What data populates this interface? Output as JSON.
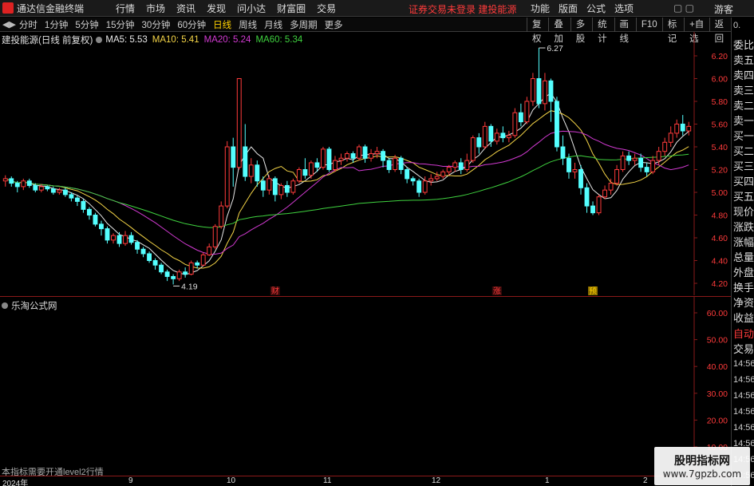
{
  "app": {
    "name": "通达信金融终端",
    "menus": [
      "行情",
      "市场",
      "资讯",
      "发现",
      "问小达",
      "财富圈",
      "交易"
    ],
    "broker_warning": "证券交易未登录  建投能源",
    "toolbar_right": [
      "功能",
      "版面",
      "公式",
      "选项"
    ],
    "guest_label": "游客"
  },
  "periods": {
    "items": [
      "分时",
      "1分钟",
      "5分钟",
      "15分钟",
      "30分钟",
      "60分钟",
      "日线",
      "周线",
      "月线",
      "多周期",
      "更多"
    ],
    "active": "日线",
    "right_buttons": [
      "复权",
      "叠加",
      "多股",
      "统计",
      "画线",
      "F10",
      "标记",
      "+自选",
      "返回"
    ]
  },
  "main_chart": {
    "stock_title": "建投能源(日线 前复权)",
    "ma_labels": [
      {
        "text": "MA5: 5.53",
        "color": "#e8e8e8"
      },
      {
        "text": "MA10: 5.41",
        "color": "#f5d547"
      },
      {
        "text": "MA20: 5.24",
        "color": "#d23ad2"
      },
      {
        "text": "MA60: 5.34",
        "color": "#3fd23f"
      }
    ],
    "annotations": {
      "high": "6.27",
      "low": "4.19"
    },
    "event_markers": [
      "财",
      "涨",
      "预"
    ]
  },
  "sub_chart": {
    "title": "乐淘公式网",
    "note": "本指标需要开通level2行情"
  },
  "time_axis": {
    "labels": [
      "2024年",
      "9",
      "10",
      "11",
      "12",
      "1",
      "2"
    ]
  },
  "right_panel": {
    "top_tag": "0.",
    "labels": [
      "委比",
      "卖五",
      "卖四",
      "卖三",
      "卖二",
      "卖一",
      "买一",
      "买二",
      "买三",
      "买四",
      "买五",
      "现价",
      "涨跌",
      "涨幅",
      "总量",
      "外盘",
      "换手",
      "净资",
      "收益",
      "自动",
      "交易"
    ],
    "times": [
      "14:56",
      "14:56",
      "14:56",
      "14:56",
      "14:56",
      "14:56",
      "14:56",
      "14:56"
    ]
  },
  "watermark": {
    "title": "股明指标网",
    "url": "www.7gpzb.com"
  },
  "chart_data": {
    "type": "candlestick",
    "price_axis": {
      "min": 4.2,
      "max": 6.2,
      "ticks": [
        "6.20",
        "6.00",
        "5.80",
        "5.60",
        "5.40",
        "5.20",
        "5.00",
        "4.80",
        "4.60",
        "4.40",
        "4.20"
      ]
    },
    "sub_axis": {
      "ticks": [
        "60.00",
        "50.00",
        "40.00",
        "30.00",
        "20.00",
        "10.00"
      ]
    },
    "candles": [
      [
        5.1,
        5.12,
        5.05,
        5.15
      ],
      [
        5.12,
        5.08,
        5.05,
        5.14
      ],
      [
        5.08,
        5.05,
        5.0,
        5.1
      ],
      [
        5.05,
        5.1,
        5.02,
        5.12
      ],
      [
        5.1,
        5.06,
        5.04,
        5.12
      ],
      [
        5.06,
        5.02,
        5.0,
        5.08
      ],
      [
        5.02,
        5.05,
        5.0,
        5.07
      ],
      [
        5.05,
        5.03,
        5.01,
        5.06
      ],
      [
        5.03,
        5.0,
        4.98,
        5.05
      ],
      [
        5.0,
        5.02,
        4.98,
        5.04
      ],
      [
        5.02,
        4.98,
        4.96,
        5.04
      ],
      [
        4.98,
        4.95,
        4.92,
        5.0
      ],
      [
        4.95,
        4.92,
        4.88,
        4.97
      ],
      [
        4.92,
        4.85,
        4.82,
        4.94
      ],
      [
        4.85,
        4.8,
        4.76,
        4.87
      ],
      [
        4.8,
        4.72,
        4.7,
        4.82
      ],
      [
        4.72,
        4.68,
        4.62,
        4.75
      ],
      [
        4.68,
        4.58,
        4.55,
        4.7
      ],
      [
        4.58,
        4.62,
        4.55,
        4.64
      ],
      [
        4.62,
        4.55,
        4.52,
        4.65
      ],
      [
        4.55,
        4.62,
        4.53,
        4.66
      ],
      [
        4.62,
        4.56,
        4.54,
        4.65
      ],
      [
        4.56,
        4.5,
        4.46,
        4.58
      ],
      [
        4.5,
        4.46,
        4.43,
        4.52
      ],
      [
        4.46,
        4.4,
        4.38,
        4.48
      ],
      [
        4.4,
        4.36,
        4.32,
        4.42
      ],
      [
        4.36,
        4.3,
        4.28,
        4.38
      ],
      [
        4.3,
        4.26,
        4.22,
        4.32
      ],
      [
        4.26,
        4.24,
        4.19,
        4.28
      ],
      [
        4.24,
        4.3,
        4.22,
        4.32
      ],
      [
        4.3,
        4.28,
        4.25,
        4.34
      ],
      [
        4.28,
        4.38,
        4.27,
        4.4
      ],
      [
        4.38,
        4.36,
        4.33,
        4.4
      ],
      [
        4.36,
        4.45,
        4.35,
        4.47
      ],
      [
        4.45,
        4.52,
        4.44,
        4.55
      ],
      [
        4.52,
        4.7,
        4.5,
        4.72
      ],
      [
        4.7,
        4.88,
        4.68,
        4.92
      ],
      [
        4.88,
        5.4,
        4.86,
        5.45
      ],
      [
        5.4,
        5.22,
        5.05,
        5.48
      ],
      [
        5.22,
        6.0,
        5.2,
        6.0
      ],
      [
        5.4,
        5.14,
        5.1,
        5.6
      ],
      [
        5.14,
        5.24,
        5.08,
        5.3
      ],
      [
        5.24,
        5.1,
        5.05,
        5.28
      ],
      [
        5.1,
        5.02,
        4.96,
        5.14
      ],
      [
        5.02,
        5.12,
        4.98,
        5.15
      ],
      [
        5.12,
        4.98,
        4.92,
        5.14
      ],
      [
        4.98,
        5.06,
        4.94,
        5.08
      ],
      [
        5.06,
        5.0,
        4.96,
        5.1
      ],
      [
        5.0,
        5.1,
        4.98,
        5.12
      ],
      [
        5.1,
        5.2,
        5.08,
        5.22
      ],
      [
        5.2,
        5.15,
        5.12,
        5.3
      ],
      [
        5.15,
        5.26,
        5.12,
        5.28
      ],
      [
        5.26,
        5.22,
        5.18,
        5.3
      ],
      [
        5.22,
        5.38,
        5.2,
        5.4
      ],
      [
        5.38,
        5.2,
        5.18,
        5.4
      ],
      [
        5.2,
        5.28,
        5.18,
        5.32
      ],
      [
        5.28,
        5.3,
        5.24,
        5.34
      ],
      [
        5.3,
        5.34,
        5.27,
        5.36
      ],
      [
        5.34,
        5.3,
        5.26,
        5.36
      ],
      [
        5.3,
        5.4,
        5.28,
        5.42
      ],
      [
        5.4,
        5.3,
        5.26,
        5.42
      ],
      [
        5.3,
        5.34,
        5.27,
        5.38
      ],
      [
        5.34,
        5.36,
        5.3,
        5.4
      ],
      [
        5.36,
        5.28,
        5.22,
        5.38
      ],
      [
        5.28,
        5.2,
        5.17,
        5.3
      ],
      [
        5.2,
        5.3,
        5.18,
        5.33
      ],
      [
        5.3,
        5.2,
        5.16,
        5.32
      ],
      [
        5.2,
        5.12,
        5.08,
        5.22
      ],
      [
        5.12,
        5.1,
        5.06,
        5.14
      ],
      [
        5.1,
        5.0,
        4.96,
        5.12
      ],
      [
        5.0,
        5.1,
        4.98,
        5.14
      ],
      [
        5.1,
        5.12,
        5.06,
        5.16
      ],
      [
        5.12,
        5.14,
        5.1,
        5.18
      ],
      [
        5.14,
        5.18,
        5.12,
        5.2
      ],
      [
        5.18,
        5.22,
        5.15,
        5.24
      ],
      [
        5.22,
        5.26,
        5.18,
        5.28
      ],
      [
        5.26,
        5.2,
        5.16,
        5.3
      ],
      [
        5.2,
        5.28,
        5.18,
        5.34
      ],
      [
        5.28,
        5.48,
        5.26,
        5.5
      ],
      [
        5.48,
        5.4,
        5.34,
        5.52
      ],
      [
        5.4,
        5.58,
        5.38,
        5.62
      ],
      [
        5.58,
        5.45,
        5.4,
        5.6
      ],
      [
        5.45,
        5.52,
        5.42,
        5.56
      ],
      [
        5.52,
        5.48,
        5.44,
        5.58
      ],
      [
        5.48,
        5.5,
        5.44,
        5.54
      ],
      [
        5.5,
        5.7,
        5.48,
        5.74
      ],
      [
        5.7,
        5.62,
        5.58,
        5.78
      ],
      [
        5.62,
        5.8,
        5.6,
        5.84
      ],
      [
        5.8,
        6.0,
        5.76,
        6.05
      ],
      [
        6.0,
        5.78,
        5.74,
        6.27
      ],
      [
        5.78,
        5.98,
        5.72,
        6.05
      ],
      [
        5.98,
        5.8,
        5.62,
        6.0
      ],
      [
        5.8,
        5.4,
        5.36,
        5.84
      ],
      [
        5.4,
        5.3,
        5.24,
        5.5
      ],
      [
        5.3,
        5.18,
        5.12,
        5.34
      ],
      [
        5.18,
        5.2,
        5.12,
        5.26
      ],
      [
        5.2,
        5.04,
        4.98,
        5.24
      ],
      [
        5.04,
        4.88,
        4.82,
        5.08
      ],
      [
        4.88,
        4.82,
        4.8,
        4.92
      ],
      [
        4.82,
        4.96,
        4.8,
        4.98
      ],
      [
        4.96,
        5.02,
        4.94,
        5.06
      ],
      [
        5.02,
        5.08,
        4.98,
        5.12
      ],
      [
        5.08,
        5.2,
        5.06,
        5.24
      ],
      [
        5.2,
        5.32,
        5.18,
        5.36
      ],
      [
        5.32,
        5.28,
        5.24,
        5.36
      ],
      [
        5.28,
        5.3,
        5.24,
        5.34
      ],
      [
        5.3,
        5.22,
        5.18,
        5.34
      ],
      [
        5.22,
        5.18,
        5.14,
        5.26
      ],
      [
        5.18,
        5.28,
        5.16,
        5.32
      ],
      [
        5.28,
        5.36,
        5.24,
        5.4
      ],
      [
        5.36,
        5.44,
        5.32,
        5.48
      ],
      [
        5.44,
        5.52,
        5.4,
        5.58
      ],
      [
        5.52,
        5.6,
        5.48,
        5.64
      ],
      [
        5.6,
        5.54,
        5.5,
        5.68
      ],
      [
        5.54,
        5.58,
        5.5,
        5.62
      ]
    ],
    "ma_series": [
      {
        "name": "MA5",
        "color": "#e8e8e8",
        "period": 5
      },
      {
        "name": "MA10",
        "color": "#f5d547",
        "period": 10
      },
      {
        "name": "MA20",
        "color": "#d23ad2",
        "period": 20
      },
      {
        "name": "MA60",
        "color": "#3fd23f",
        "period": 60
      }
    ],
    "colors": {
      "up": "#ff3b3b",
      "down": "#54ffff"
    },
    "grid": false
  }
}
